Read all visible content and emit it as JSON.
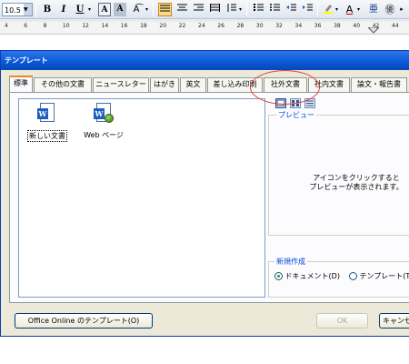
{
  "toolbar": {
    "font_size": "10.5",
    "bold": "B",
    "italic": "I",
    "underline": "U",
    "char_border": "A",
    "char_shading": "A",
    "phonetic": "亜",
    "enclose": "㊝"
  },
  "ruler": {
    "ticks": [
      "4",
      "6",
      "8",
      "10",
      "12",
      "14",
      "16",
      "18",
      "20",
      "22",
      "24",
      "26",
      "28",
      "30",
      "32",
      "34",
      "36",
      "38",
      "40",
      "42",
      "44"
    ]
  },
  "dialog": {
    "title": "テンプレート",
    "tabs": [
      "標準",
      "その他の文書",
      "ニュースレター",
      "はがき",
      "英文",
      "差し込み印刷",
      "社外文書",
      "社内文書",
      "論文・報告書"
    ],
    "templates": [
      {
        "label": "新しい文書"
      },
      {
        "label": "Web ページ"
      }
    ],
    "preview": {
      "legend": "プレビュー",
      "line1": "アイコンをクリックすると",
      "line2": "プレビューが表示されます。"
    },
    "create_new": {
      "legend": "新規作成",
      "document_label": "ドキュメント(D)",
      "template_label": "テンプレート(T)"
    },
    "online_button": "Office Online のテンプレート(O)",
    "ok_button": "OK",
    "cancel_button": "キャンセル"
  },
  "colors": {
    "title_bar": "#0a58d6",
    "highlight_circle": "#e03a3a",
    "dialog_face": "#ece9d8"
  }
}
